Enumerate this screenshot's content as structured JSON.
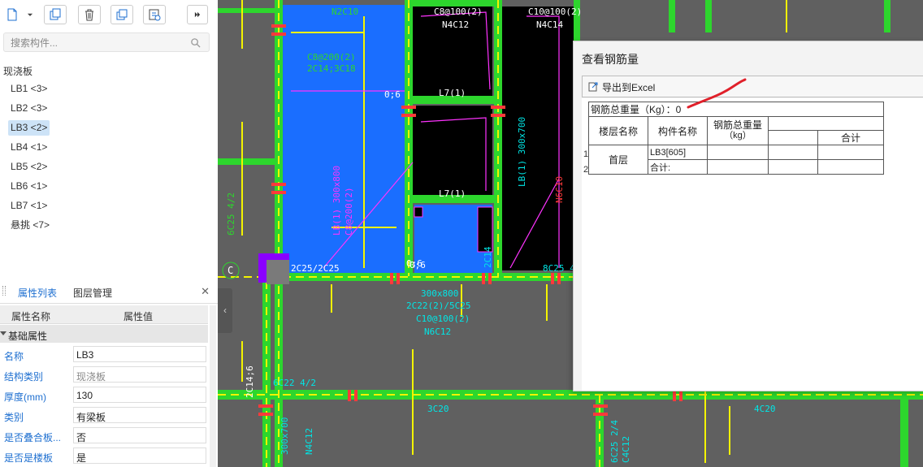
{
  "toolbar": {
    "buttons": [
      {
        "name": "new-component-icon"
      },
      {
        "name": "dropdown-arrow-icon"
      },
      {
        "name": "copy-component-icon"
      },
      {
        "name": "delete-icon"
      },
      {
        "name": "layer-copy-icon"
      },
      {
        "name": "sort-icon"
      },
      {
        "name": "more-icon"
      }
    ]
  },
  "search": {
    "placeholder": "搜索构件..."
  },
  "tree": {
    "root": "现浇板",
    "items": [
      "LB1 <3>",
      "LB2 <3>",
      "LB3 <2>",
      "LB4 <1>",
      "LB5 <2>",
      "LB6 <1>",
      "LB7 <1>",
      "悬挑 <7>"
    ],
    "selected_index": 2
  },
  "properties": {
    "tabs": [
      "属性列表",
      "图层管理"
    ],
    "close": "✕",
    "col_name": "属性名称",
    "col_value": "属性值",
    "group": "基础属性",
    "rows": [
      {
        "name": "名称",
        "value": "LB3"
      },
      {
        "name": "结构类别",
        "value": "现浇板"
      },
      {
        "name": "厚度(mm)",
        "value": "130"
      },
      {
        "name": "类别",
        "value": "有梁板"
      },
      {
        "name": "是否叠合板...",
        "value": "否"
      },
      {
        "name": "是否是楼板",
        "value": "是"
      }
    ]
  },
  "cad": {
    "labels": [
      "N2C10",
      "C8@100(2)",
      "N4C12",
      "C10@100(2)",
      "N4C14",
      "2C25/2C25",
      "L7(1)",
      "0;6",
      "L7(1)",
      "0;6",
      "C8@200(2)",
      "2C14;3C18",
      "300x800",
      "2C22(2)/5C25",
      "C10@100(2)",
      "N6C12",
      "6C25 4/2",
      "3C20",
      "4C20",
      "2C14;6",
      "6C22 4/2",
      "300x700",
      "N4C12",
      "0;6",
      "6C25 2/4",
      "C4C12",
      "8C25 4/2",
      "LB(1) 300x700",
      "N6C10",
      "LB(1) 300x800",
      "C8@200(2)",
      "2C14",
      "C"
    ]
  },
  "dialog": {
    "title": "查看钢筋量",
    "export_label": "导出到Excel",
    "total_label": "钢筋总重量（Kg）：0",
    "headers": {
      "floor": "楼层名称",
      "component": "构件名称",
      "weight": "钢筋总重量",
      "unit": "（kg）",
      "sum": "合计"
    },
    "rows": [
      {
        "num": "1",
        "floor": "首层",
        "component": "LB3[605]"
      },
      {
        "num": "2",
        "component": "合计:"
      }
    ]
  },
  "colors": {
    "cad_bg": "#606060",
    "slab_blue": "#1a6eff",
    "beam_green": "#2dd62d",
    "rebar_yellow": "#f4f400",
    "magenta": "#ff33ff",
    "select_blue": "#cde3f7",
    "accent": "#1e6fd0"
  }
}
